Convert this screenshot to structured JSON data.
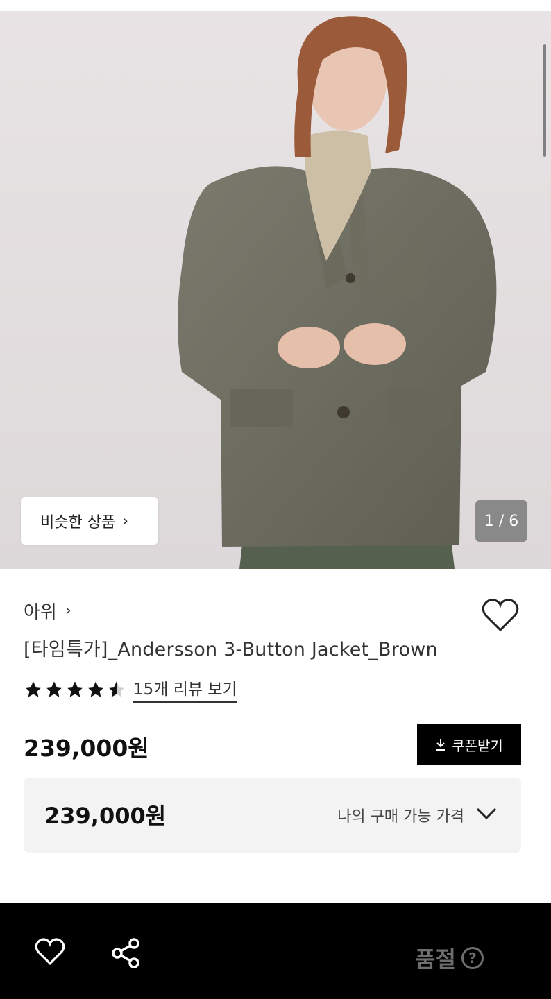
{
  "gallery": {
    "similar_label": "비슷한 상품",
    "counter": "1 / 6",
    "current_image": 1,
    "total_images": 6
  },
  "product": {
    "brand": "아위",
    "title": "[타임특가]_Andersson 3-Button Jacket_Brown",
    "rating": 4.5,
    "review_link": "15개 리뷰 보기",
    "price": "239,000원",
    "coupon_label": "쿠폰받기"
  },
  "price_box": {
    "price": "239,000원",
    "label": "나의 구매 가능 가격"
  },
  "bottom_bar": {
    "status": "품절",
    "help_glyph": "?"
  },
  "icons": {
    "wish": "heart-outline-icon",
    "share": "share-icon",
    "download": "download-icon",
    "dropdown": "chevron-down-icon"
  }
}
